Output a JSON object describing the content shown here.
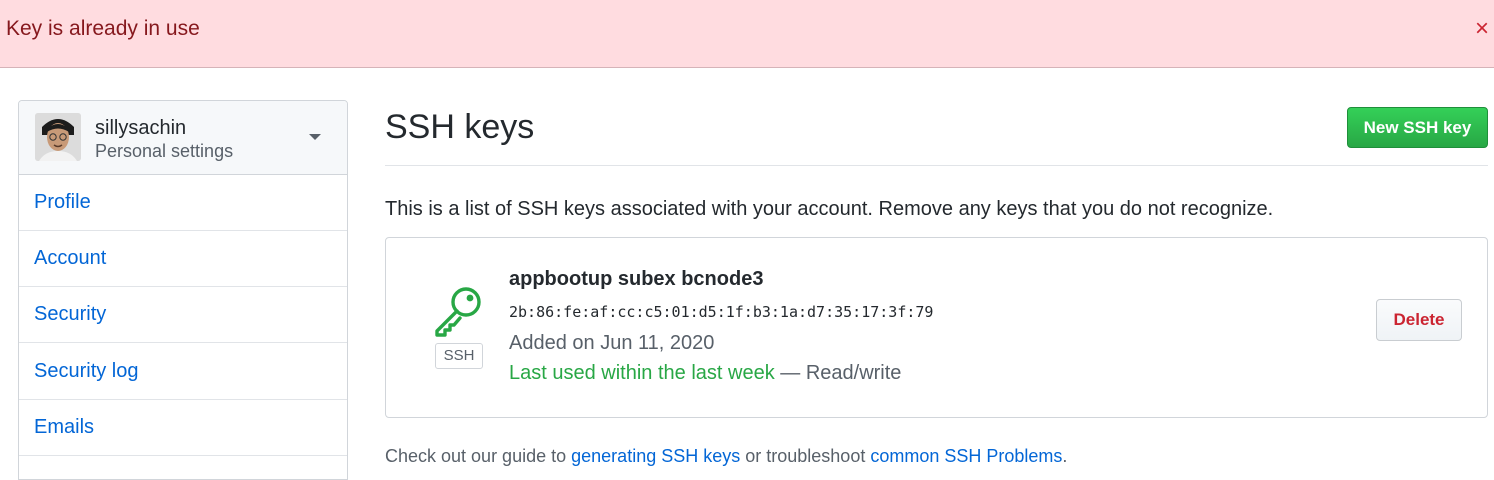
{
  "flash": {
    "message": "Key is already in use",
    "close_symbol": "×"
  },
  "sidebar": {
    "user": {
      "name": "sillysachin",
      "subtitle": "Personal settings"
    },
    "items": [
      {
        "label": "Profile"
      },
      {
        "label": "Account"
      },
      {
        "label": "Security"
      },
      {
        "label": "Security log"
      },
      {
        "label": "Emails"
      }
    ]
  },
  "main": {
    "title": "SSH keys",
    "new_key_button": "New SSH key",
    "intro": "This is a list of SSH keys associated with your account. Remove any keys that you do not recognize.",
    "keys": [
      {
        "type_badge": "SSH",
        "name": "appbootup subex bcnode3",
        "fingerprint": "2b:86:fe:af:cc:c5:01:d5:1f:b3:1a:d7:35:17:3f:79",
        "added": "Added on Jun 11, 2020",
        "last_used": "Last used within the last week",
        "access": "— Read/write",
        "delete_button": "Delete",
        "icon": "key-icon"
      }
    ],
    "footer": {
      "prefix": "Check out our guide to",
      "link1": "generating SSH keys",
      "middle": "or troubleshoot",
      "link2": "common SSH Problems",
      "suffix": "."
    }
  },
  "colors": {
    "flash_bg": "#ffdce0",
    "flash_text": "#86181d",
    "link": "#0366d6",
    "primary_button": "#28a745",
    "danger": "#cb2431",
    "key_icon": "#28a745"
  }
}
